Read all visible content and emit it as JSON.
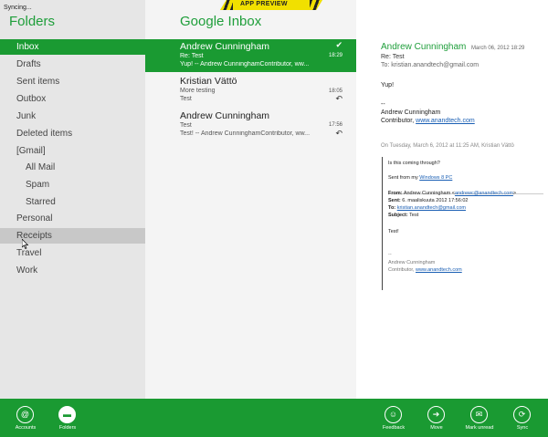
{
  "sync_status": "Syncing...",
  "folders": {
    "title": "Folders",
    "items": [
      {
        "label": "Inbox"
      },
      {
        "label": "Drafts"
      },
      {
        "label": "Sent items"
      },
      {
        "label": "Outbox"
      },
      {
        "label": "Junk"
      },
      {
        "label": "Deleted items"
      },
      {
        "label": "[Gmail]"
      },
      {
        "label": "All Mail"
      },
      {
        "label": "Spam"
      },
      {
        "label": "Starred"
      },
      {
        "label": "Personal"
      },
      {
        "label": "Receipts"
      },
      {
        "label": "Travel"
      },
      {
        "label": "Work"
      }
    ]
  },
  "banner": {
    "label": "APP PREVIEW"
  },
  "list": {
    "title": "Google Inbox",
    "messages": [
      {
        "sender": "Andrew Cunningham",
        "subject": "Re: Test",
        "preview": "Yup! -- Andrew CunninghamContributor, ww...",
        "time": "18:29",
        "status_icon": "checkmark-icon"
      },
      {
        "sender": "Kristian Vättö",
        "subject": "More testing",
        "preview": "Test",
        "time": "18:05",
        "status_icon": "reply-icon"
      },
      {
        "sender": "Andrew Cunningham",
        "subject": "Test",
        "preview": "Test! -- Andrew CunninghamContributor, ww...",
        "time": "17:56",
        "status_icon": "reply-icon"
      }
    ]
  },
  "reading": {
    "from": "Andrew Cunningham",
    "date": "March 06, 2012  18:29",
    "subject": "Re: Test",
    "to": "To: kristian.anandtech@gmail.com",
    "body": "Yup!",
    "dash": "--",
    "sig_name": "Andrew Cunningham",
    "sig_prefix": "Contributor, ",
    "sig_link": "www.anandtech.com",
    "quote_header": "On Tuesday, March 6, 2012 at 11:25 AM, Kristian Vättö",
    "quote": {
      "line1": "Is this coming through?",
      "sent_from_prefix": "Sent from my ",
      "sent_from_link": "Windows 8 PC",
      "from_label": "From:",
      "from_value": " Andrew Cunningham <",
      "from_link": "andrewc@anandtech.com",
      "from_end": ">",
      "sent_label": "Sent:",
      "sent_value": " 6. maaliskuuta 2012 17:56:02",
      "to_label": "To:",
      "to_link": "kristian.anandtech@gmail.com",
      "subject_label": "Subject:",
      "subject_value": " Test",
      "body": "Test!",
      "dash": "--",
      "sig_name": "Andrew Cunningham",
      "sig_prefix": "Contributor, ",
      "sig_link": "www.anandtech.com"
    }
  },
  "app_bar": {
    "accounts": "Accounts",
    "folders": "Folders",
    "feedback": "Feedback",
    "move": "Move",
    "mark_unread": "Mark unread",
    "sync": "Sync"
  },
  "colors": {
    "accent": "#1a9a32",
    "banner": "#f1e000"
  }
}
